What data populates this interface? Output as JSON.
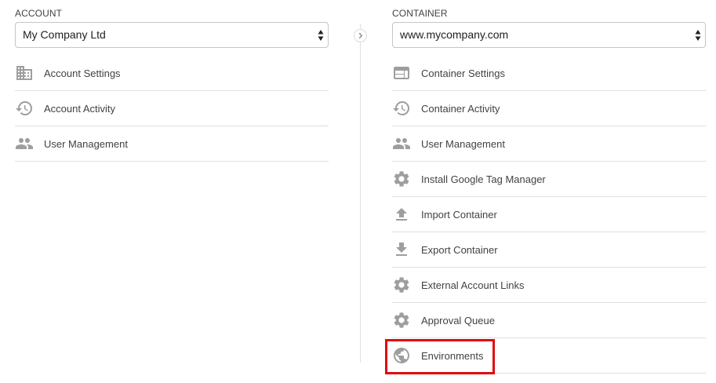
{
  "account": {
    "label": "ACCOUNT",
    "selected": "My Company Ltd",
    "items": [
      {
        "label": "Account Settings",
        "icon": "building-icon"
      },
      {
        "label": "Account Activity",
        "icon": "history-icon"
      },
      {
        "label": "User Management",
        "icon": "people-icon"
      }
    ]
  },
  "container": {
    "label": "CONTAINER",
    "selected": "www.mycompany.com",
    "items": [
      {
        "label": "Container Settings",
        "icon": "browser-window-icon"
      },
      {
        "label": "Container Activity",
        "icon": "history-icon"
      },
      {
        "label": "User Management",
        "icon": "people-icon"
      },
      {
        "label": "Install Google Tag Manager",
        "icon": "gear-icon"
      },
      {
        "label": "Import Container",
        "icon": "upload-icon"
      },
      {
        "label": "Export Container",
        "icon": "download-icon"
      },
      {
        "label": "External Account Links",
        "icon": "gear-icon"
      },
      {
        "label": "Approval Queue",
        "icon": "gear-icon"
      },
      {
        "label": "Environments",
        "icon": "globe-icon"
      }
    ]
  },
  "colors": {
    "icon": "#9e9e9e",
    "highlight": "#e10a0a",
    "divider": "#e0e0e0"
  }
}
